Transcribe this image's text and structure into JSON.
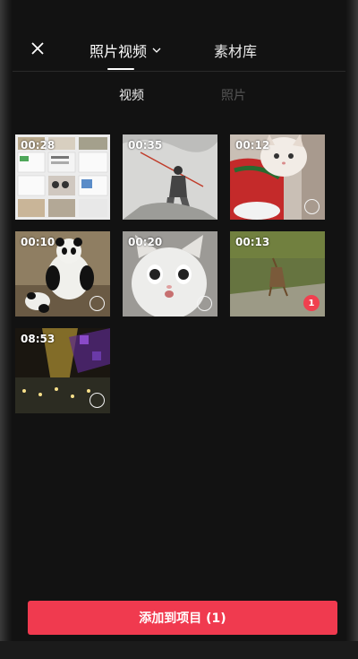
{
  "header": {
    "close_icon": "close-icon",
    "tab_active_label": "照片视频",
    "tab_library_label": "素材库",
    "dropdown_icon": "chevron-down-icon"
  },
  "subtabs": {
    "video_label": "视频",
    "photo_label": "照片"
  },
  "media": [
    {
      "duration": "00:28",
      "selected": false
    },
    {
      "duration": "00:35",
      "selected": false
    },
    {
      "duration": "00:12",
      "selected": false
    },
    {
      "duration": "00:10",
      "selected": false
    },
    {
      "duration": "00:20",
      "selected": false
    },
    {
      "duration": "00:13",
      "selected": true,
      "selection_index": "1"
    },
    {
      "duration": "08:53",
      "selected": false
    }
  ],
  "footer": {
    "add_button_label": "添加到项目 (1)"
  },
  "colors": {
    "accent": "#f03a4f",
    "background": "#121212"
  }
}
